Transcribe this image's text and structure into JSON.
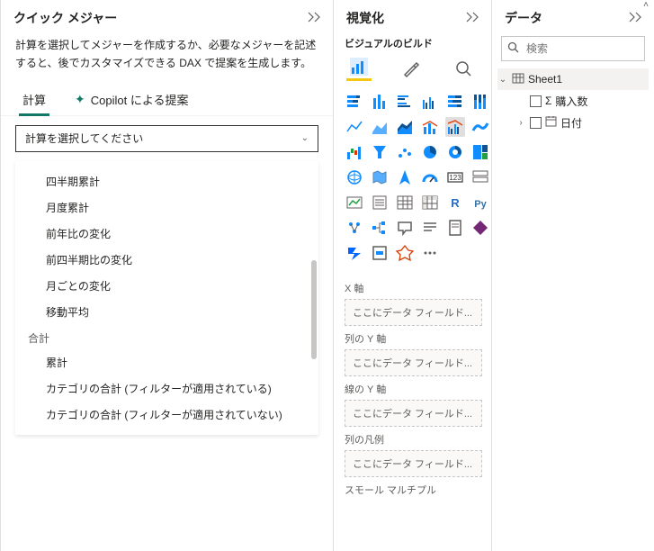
{
  "quick_measure": {
    "title": "クイック メジャー",
    "desc": "計算を選択してメジャーを作成するか、必要なメジャーを記述すると、後でカスタマイズできる DAX で提案を生成します。",
    "tabs": {
      "calc": "計算",
      "copilot": "Copilot による提案"
    },
    "combo_placeholder": "計算を選択してください",
    "items": {
      "i0": "四半期累計",
      "i1": "月度累計",
      "i2": "前年比の変化",
      "i3": "前四半期比の変化",
      "i4": "月ごとの変化",
      "i5": "移動平均"
    },
    "group_total": "合計",
    "total_items": {
      "t0": "累計",
      "t1": "カテゴリの合計 (フィルターが適用されている)",
      "t2": "カテゴリの合計 (フィルターが適用されていない)"
    }
  },
  "viz": {
    "title": "視覚化",
    "subtitle": "ビジュアルのビルド",
    "wells": {
      "x": "X 軸",
      "coly": "列の Y 軸",
      "liney": "線の Y 軸",
      "legend": "列の凡例",
      "small": "スモール マルチプル"
    },
    "placeholder": "ここにデータ フィールド..."
  },
  "data": {
    "title": "データ",
    "search_placeholder": "検索",
    "tree": {
      "sheet": "Sheet1",
      "f0": "購入数",
      "f1": "日付"
    }
  }
}
